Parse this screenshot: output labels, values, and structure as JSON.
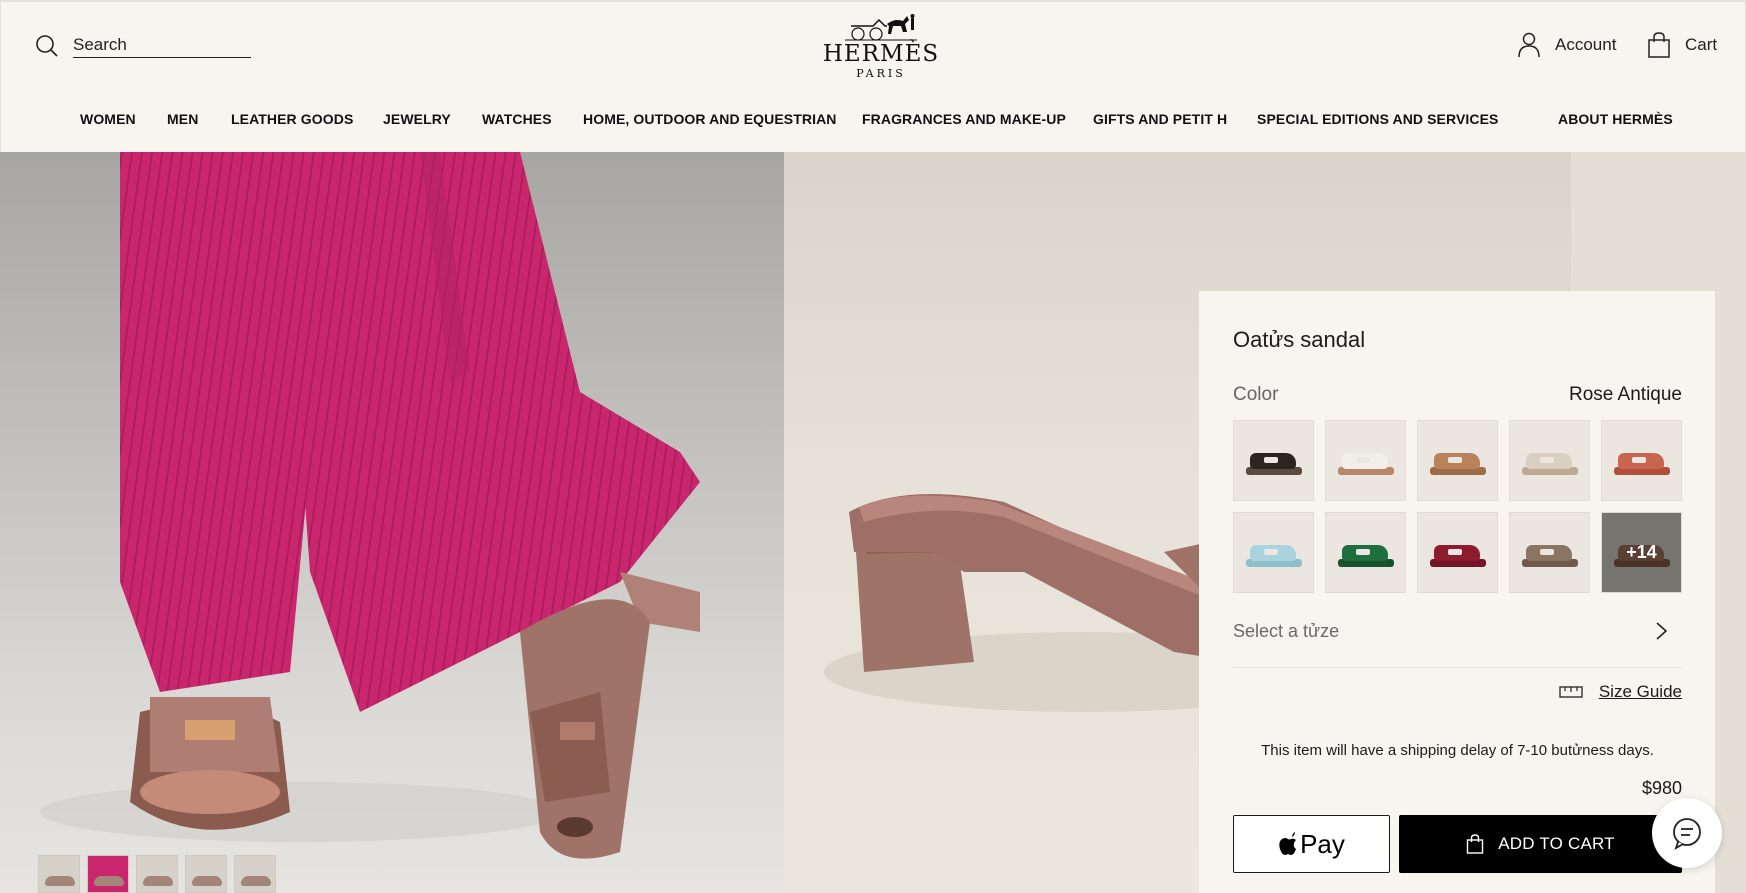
{
  "header": {
    "search_label": "Search",
    "logo_title": "HERMÈS",
    "logo_sub": "PARIS",
    "account_label": "Account",
    "cart_label": "Cart"
  },
  "nav": {
    "items": [
      "WOMEN",
      "MEN",
      "LEATHER GOODS",
      "JEWELRY",
      "WATCHES",
      "HOME, OUTDOOR AND EQUESTRIAN",
      "FRAGRANCES AND MAKE-UP",
      "GIFTS AND PETIT H",
      "SPECIAL EDITIONS AND SERVICES",
      "ABOUT HERMÈS"
    ]
  },
  "gallery": {
    "thumbnail_count": 5,
    "active_thumbnail": 2
  },
  "product": {
    "title": "Oatửs sandal",
    "color_label": "Color",
    "color_value": "Rose Antique",
    "swatches": [
      {
        "color": "#2b2522",
        "accent": "#5a4a40"
      },
      {
        "color": "#f2efe8",
        "accent": "#b98868"
      },
      {
        "color": "#b8835a",
        "accent": "#9e6d47"
      },
      {
        "color": "#d9cfc2",
        "accent": "#c0a993"
      },
      {
        "color": "#c9644f",
        "accent": "#b14f3c"
      },
      {
        "color": "#a9d4de",
        "accent": "#8fbfcb"
      },
      {
        "color": "#1f6e3d",
        "accent": "#17542e"
      },
      {
        "color": "#8e1c30",
        "accent": "#731527"
      },
      {
        "color": "#8b7462",
        "accent": "#6f5a4a"
      },
      {
        "color": "#5a3f35",
        "accent": "#4a3229"
      }
    ],
    "more_swatches_label": "+14",
    "size_placeholder": "Select a tửze",
    "size_guide_label": "Size Guide",
    "shipping_note": "This item will have a shipping delay of 7-10 butửness days.",
    "price": "$980",
    "applepay_label": "Pay",
    "add_to_cart_label": "ADD TO CART"
  },
  "colors": {
    "background": "#f8f5f0",
    "pants_pink": "#c9266e",
    "sandal_rose": "#a07369",
    "button_black": "#000000"
  }
}
